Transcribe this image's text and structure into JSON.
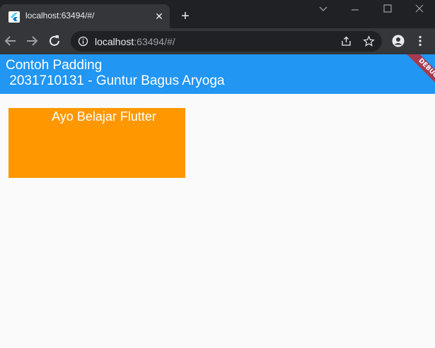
{
  "browser": {
    "tab_title": "localhost:63494/#/",
    "tab_close": "✕",
    "new_tab": "+",
    "url_host": "localhost",
    "url_rest": ":63494/#/"
  },
  "app": {
    "title_line1": "Contoh Padding",
    "title_line2": " 2031710131 - Guntur Bagus Aryoga",
    "debug_label": "DEBUG",
    "box_text": "Ayo Belajar Flutter"
  },
  "colors": {
    "appbar": "#2196f3",
    "box": "#ff9800",
    "debug_banner": "#a63a50"
  }
}
